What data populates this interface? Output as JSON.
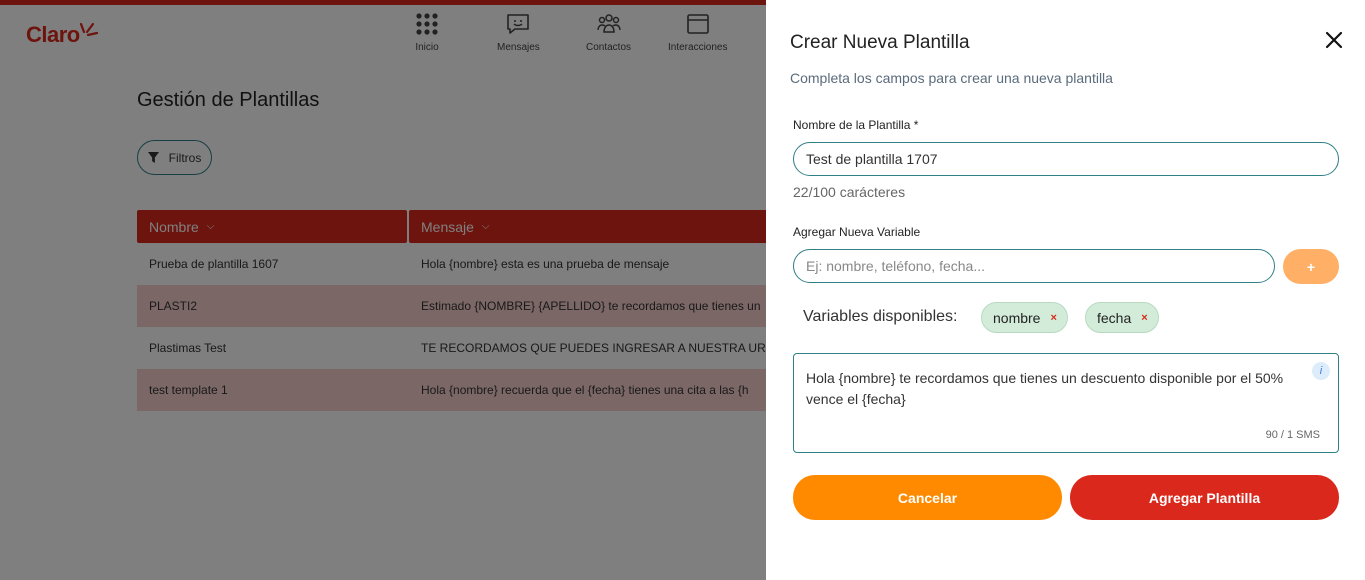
{
  "app": {
    "logo": "Claro",
    "nav": [
      {
        "label": "Inicio",
        "icon": "grid-icon"
      },
      {
        "label": "Mensajes",
        "icon": "message-icon"
      },
      {
        "label": "Contactos",
        "icon": "contacts-icon"
      },
      {
        "label": "Interacciones",
        "icon": "window-icon"
      }
    ],
    "page_title": "Gestión de Plantillas",
    "filter_label": "Filtros",
    "table": {
      "columns": [
        "Nombre",
        "Mensaje"
      ],
      "rows": [
        {
          "nombre": "Prueba de plantilla 1607",
          "mensaje": "Hola {nombre} esta es una prueba de mensaje"
        },
        {
          "nombre": "PLASTI2",
          "mensaje": "Estimado {NOMBRE} {APELLIDO} te recordamos que tienes un"
        },
        {
          "nombre": "Plastimas Test",
          "mensaje": "TE RECORDAMOS QUE PUEDES INGRESAR A NUESTRA URL"
        },
        {
          "nombre": "test template 1",
          "mensaje": "Hola {nombre} recuerda que el {fecha} tienes una cita a las {h"
        }
      ]
    }
  },
  "drawer": {
    "title": "Crear Nueva Plantilla",
    "subtitle": "Completa los campos para crear una nueva plantilla",
    "name_label": "Nombre de la Plantilla *",
    "name_value": "Test de plantilla 1707",
    "name_counter": "22/100 carácteres",
    "var_label": "Agregar Nueva Variable",
    "var_placeholder": "Ej: nombre, teléfono, fecha...",
    "add_var_label": "+",
    "vars_available_label": "Variables disponibles:",
    "variables": [
      "nombre",
      "fecha"
    ],
    "chip_remove": "×",
    "message_line1": "Hola {nombre} te recordamos que tienes un descuento disponible por el 50%",
    "message_line2": "vence el {fecha}",
    "info_glyph": "i",
    "sms_counter": "90 / 1 SMS",
    "cancel_label": "Cancelar",
    "submit_label": "Agregar Plantilla"
  },
  "colors": {
    "brand_red": "#da291c",
    "accent_teal": "#2f7f86",
    "orange": "#ff8a00",
    "chip_green": "#d3ecd9"
  }
}
